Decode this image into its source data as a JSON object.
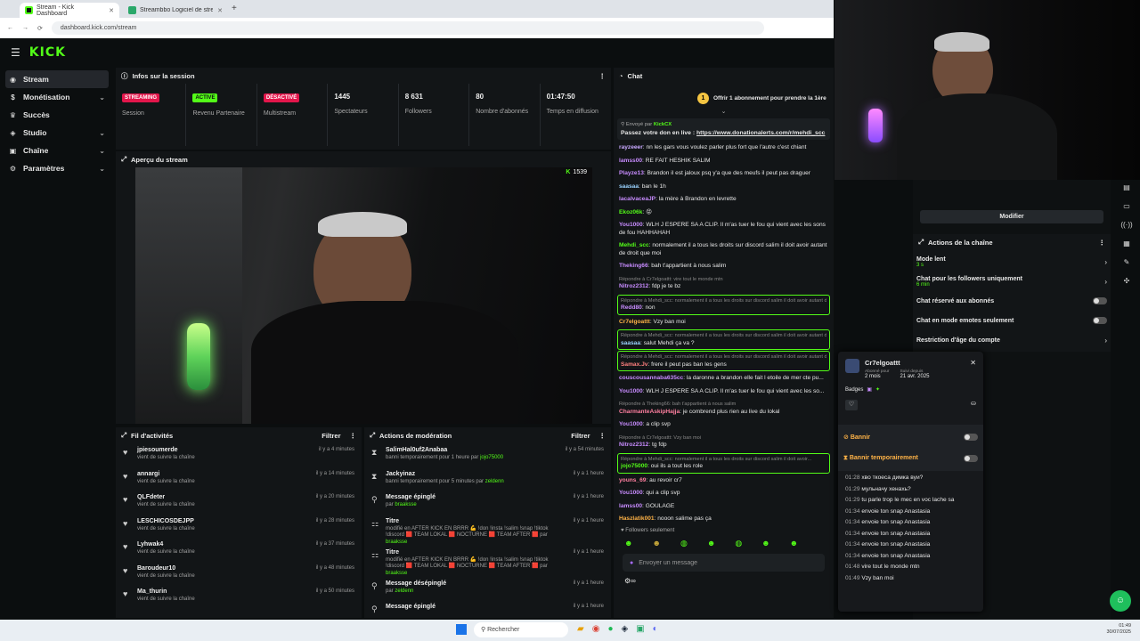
{
  "browser": {
    "tabs": [
      {
        "label": "Stream - Kick Dashboard"
      },
      {
        "label": "Streambbo Logiciel de stream..."
      }
    ],
    "url": "dashboard.kick.com/stream"
  },
  "brand": {
    "logo": "KICK",
    "accent": "#53fc18"
  },
  "sidebar": {
    "items": [
      {
        "label": "Stream",
        "icon": "broadcast-icon"
      },
      {
        "label": "Monétisation",
        "icon": "dollar-icon"
      },
      {
        "label": "Succès",
        "icon": "trophy-icon"
      },
      {
        "label": "Studio",
        "icon": "palette-icon"
      },
      {
        "label": "Chaîne",
        "icon": "tv-icon"
      },
      {
        "label": "Paramètres",
        "icon": "gear-icon"
      }
    ]
  },
  "session": {
    "title": "Infos sur la session",
    "stats": [
      {
        "badge": "STREAMING",
        "label": "Session"
      },
      {
        "badge": "ACTIVE",
        "label": "Revenu Partenaire"
      },
      {
        "badge": "DÉSACTIVÉ",
        "label": "Multistream"
      },
      {
        "value": "1445",
        "label": "Spectateurs"
      },
      {
        "value": "8 631",
        "label": "Followers"
      },
      {
        "value": "80",
        "label": "Nombre d'abonnés"
      },
      {
        "value": "01:47:50",
        "label": "Temps en diffusion"
      }
    ]
  },
  "preview": {
    "title": "Aperçu du stream",
    "viewers": "1539"
  },
  "activity": {
    "title": "Fil d'activités",
    "filter": "Filtrer",
    "items": [
      {
        "name": "jpiesoumerde",
        "sub": "vient de suivre la chaîne",
        "time": "il y a 4 minutes"
      },
      {
        "name": "annargi",
        "sub": "vient de suivre la chaîne",
        "time": "il y a 14 minutes"
      },
      {
        "name": "QLFdeter",
        "sub": "vient de suivre la chaîne",
        "time": "il y a 20 minutes"
      },
      {
        "name": "LESCHICOSDEJPP",
        "sub": "vient de suivre la chaîne",
        "time": "il y a 28 minutes"
      },
      {
        "name": "Lyhwak4",
        "sub": "vient de suivre la chaîne",
        "time": "il y a 37 minutes"
      },
      {
        "name": "Baroudeur10",
        "sub": "vient de suivre la chaîne",
        "time": "il y a 48 minutes"
      },
      {
        "name": "Ma_thurin",
        "sub": "vient de suivre la chaîne",
        "time": "il y a 50 minutes"
      }
    ]
  },
  "moderation": {
    "title": "Actions de modération",
    "filter": "Filtrer",
    "items": [
      {
        "name": "SalimHal0uf2Anabaa",
        "sub": "banni temporairement pour 1 heure par",
        "by": "jojo75000",
        "time": "il y a 54 minutes"
      },
      {
        "name": "Jackyinaz",
        "sub": "banni temporairement pour 5 minutes par",
        "by": "zeldenn",
        "time": "il y a 1 heure"
      },
      {
        "name": "Message épinglé",
        "sub": "par",
        "by": "braaksse",
        "time": "il y a 1 heure"
      },
      {
        "name": "Titre",
        "sub": "modifié en AFTER KICK EN BRRR 💪 !don !insta !salim !snap !tiktok !discord 🟥 TEAM LOKAL 🟥 NOCTURNE 🟥 TEAM AFTER 🟥 par",
        "by": "braaksse",
        "time": "il y a 1 heure"
      },
      {
        "name": "Titre",
        "sub": "modifié en AFTER KICK EN BRRR 💪 !don !insta !salim !snap !tiktok !discord 🟥 TEAM LOKAL 🟥 NOCTURNE 🟥 TEAM AFTER 🟥 par",
        "by": "braaksse",
        "time": "il y a 1 heure"
      },
      {
        "name": "Message désépinglé",
        "sub": "par",
        "by": "zeldenn",
        "time": "il y a 1 heure"
      },
      {
        "name": "Message épinglé",
        "sub": "",
        "by": "",
        "time": "il y a 1 heure"
      }
    ]
  },
  "chat": {
    "title": "Chat",
    "goal": "Offrir 1 abonnement pour prendre la 1ère",
    "pinned_sent_by": "Envoyé par",
    "pinned_user": "KickCX",
    "pinned_text": "Passez votre don en live :",
    "pinned_link": "https://www.donationalerts.com/r/mehdi_scc",
    "messages": [
      {
        "user": "rayzeeer",
        "color": "#c8a8ff",
        "text": "nn les gars vous voulez parler plus fort que l'autre c'est chiant"
      },
      {
        "user": "lamss00",
        "color": "#c88cff",
        "text": "RE FAIT HESHIK SALIM"
      },
      {
        "user": "Playze13",
        "color": "#c88cff",
        "text": "Brandon il est jaloux psq y'a que des meufs il peut pas draguer"
      },
      {
        "user": "saasaa",
        "color": "#9ad3ff",
        "text": "ban le 1h"
      },
      {
        "user": "lacalvaceaJP",
        "color": "#c88cff",
        "text": "la mère à Brandon en levrette"
      },
      {
        "user": "Ekoz06k",
        "color": "#53fc18",
        "text": "😡"
      },
      {
        "user": "You1000",
        "color": "#c88cff",
        "text": "WLH J ESPERE SA A CLIP. Il m'as tuer le fou qui vient avec les sons de fou HAHHAHAH"
      },
      {
        "user": "Mehdi_scc",
        "color": "#53fc18",
        "text": "normalement il a tous les droits sur discord salim il doit avoir autant de droit que moi"
      },
      {
        "user": "Theking66",
        "color": "#c88cff",
        "text": "bah t'appartient à nous salim"
      },
      {
        "reply": "Répondre à Cr7elgoattt: vire tout le monde mtn",
        "user": "Nitroz2312",
        "color": "#c88cff",
        "text": "fdp je te bz"
      },
      {
        "reply": "Répondre à Mehdi_scc: normalement il a tous les droits sur discord salim il doit avoir autant de droit que...",
        "user": "Redd80",
        "color": "#c88cff",
        "text": "non",
        "boxed": true
      },
      {
        "user": "Cr7elgoattt",
        "color": "#ffb347",
        "text": "Vzy ban moi"
      },
      {
        "reply": "Répondre à Mehdi_scc: normalement il a tous les droits sur discord salim il doit avoir autant de droit...",
        "user": "saasaa",
        "color": "#9ad3ff",
        "text": "salut Mehdi ça va ?",
        "boxed": true
      },
      {
        "reply": "Répondre à Mehdi_scc: normalement il a tous les droits sur discord salim il doit avoir autant de droit...",
        "user": "Samax.Jv",
        "color": "#ff7f7f",
        "text": "frere il peut pas ban les gens",
        "boxed": true
      },
      {
        "user": "couscousannaba635cc",
        "color": "#c88cff",
        "text": "la daronne a brandon elle fait l etoile de mer cte pu..."
      },
      {
        "user": "You1000",
        "color": "#c88cff",
        "text": "WLH J ESPERE SA A CLIP. Il m'as tuer le fou qui vient avec les so..."
      },
      {
        "reply": "Répondre à Theking66: bah t'appartient à nous salim",
        "user": "CharmanteAskipHajja",
        "color": "#ff7fa0",
        "text": "je combrend plus rien au live du lokal"
      },
      {
        "user": "You1000",
        "color": "#c88cff",
        "text": "a clip svp"
      },
      {
        "reply": "Répondre à Cr7elgoattt: Vzy ban moi",
        "user": "Nitroz2312",
        "color": "#c88cff",
        "text": "tg fdp"
      },
      {
        "reply": "Répondre à Mehdi_scc: normalement il a tous les droits sur discord salim il doit avoir...",
        "user": "jojo75000",
        "color": "#53fc18",
        "text": "oui ils a tout les role",
        "boxed": true
      },
      {
        "user": "youns_69",
        "color": "#ff7fa0",
        "text": "au revoir cr7"
      },
      {
        "user": "You1000",
        "color": "#c88cff",
        "text": "qui a clip svp"
      },
      {
        "user": "lamss00",
        "color": "#c88cff",
        "text": "GOULAGE"
      },
      {
        "user": "Haszlatik001",
        "color": "#ffb347",
        "text": "nooon salime pas ça"
      }
    ],
    "followers_only": "Followers seulement",
    "placeholder": "Envoyer un message"
  },
  "right": {
    "modify": "Modifier",
    "channel_actions_title": "Actions de la chaîne",
    "actions": [
      {
        "label": "Mode lent",
        "sub": "3 s"
      },
      {
        "label": "Chat pour les followers uniquement",
        "sub": "6 min"
      },
      {
        "label": "Chat réservé aux abonnés",
        "sub": ""
      },
      {
        "label": "Chat en mode emotes seulement",
        "sub": ""
      },
      {
        "label": "Restriction d'âge du compte",
        "sub": ""
      }
    ]
  },
  "usercard": {
    "username": "Cr7elgoattt",
    "sub_label": "Abonné pour",
    "sub_value": "2 mois",
    "follow_label": "Suivi depuis",
    "follow_value": "21 avr. 2025",
    "badges_label": "Badges",
    "ban_label": "Bannir",
    "timeout_label": "Bannir temporairement",
    "history": [
      {
        "t": "01:28",
        "m": "хво ткоеса димка вуи?"
      },
      {
        "t": "01:29",
        "m": "мульначу хенахь?"
      },
      {
        "t": "01:29",
        "m": "tu parle trop le mec en voc lache sa"
      },
      {
        "t": "01:34",
        "m": "envoie ton snap Anastasia"
      },
      {
        "t": "01:34",
        "m": "envoie ton snap Anastasia"
      },
      {
        "t": "01:34",
        "m": "envoie ton snap Anastasia"
      },
      {
        "t": "01:34",
        "m": "envoie ton snap Anastasia"
      },
      {
        "t": "01:34",
        "m": "envoie ton snap Anastasia"
      },
      {
        "t": "01:48",
        "m": "vire tout le monde mtn"
      },
      {
        "t": "01:49",
        "m": "Vzy ban moi"
      }
    ]
  },
  "taskbar": {
    "search": "Rechercher",
    "time": "01:49",
    "date": "30/07/2025"
  }
}
